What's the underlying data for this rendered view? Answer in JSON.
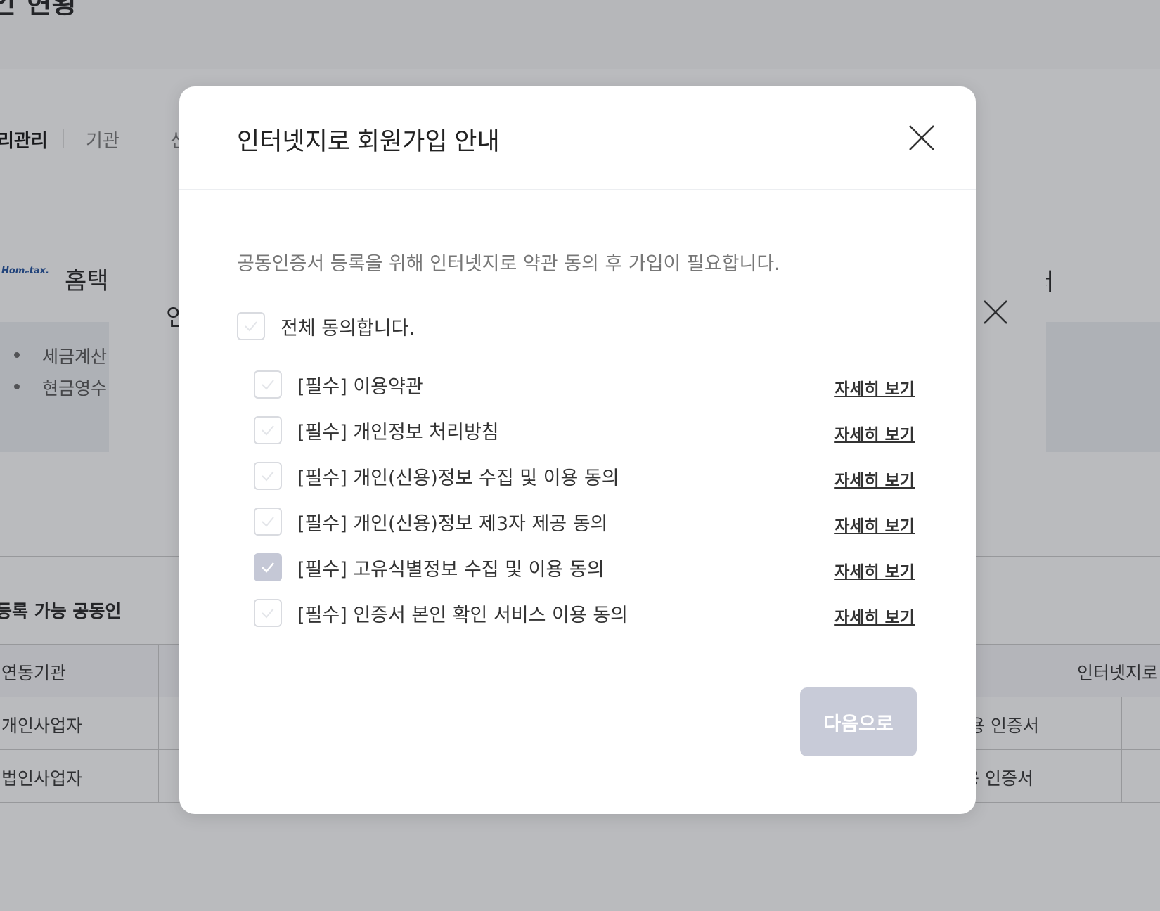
{
  "background": {
    "page_title_fragment": "인 현황",
    "tabs": [
      {
        "label": "리관리"
      },
      {
        "label": "기관"
      },
      {
        "label": "신"
      }
    ],
    "provider": {
      "logo_text": "Homₑtax.",
      "name_fragment": "홈택",
      "right_fragment": "서"
    },
    "info_items": [
      {
        "text": "세금계산"
      },
      {
        "text": "현금영수"
      }
    ],
    "secondary_modal_title_fragment": "인",
    "section_title_fragment": "등록 가능 공동인",
    "table": {
      "header": {
        "col1": "연동기관",
        "right": "인터넷지로"
      },
      "rows": [
        {
          "col1": "개인사업자",
          "right": "용 인증서"
        },
        {
          "col1": "법인사업자",
          "right": "용 인증서"
        }
      ]
    }
  },
  "dialog": {
    "title": "인터넷지로 회원가입 안내",
    "description": "공동인증서 등록을 위해 인터넷지로 약관 동의 후 가입이 필요합니다.",
    "agree_all_label": "전체 동의합니다.",
    "agree_all_checked": false,
    "terms": [
      {
        "label": "[필수] 이용약관",
        "link": "자세히 보기",
        "checked": false
      },
      {
        "label": "[필수] 개인정보 처리방침",
        "link": "자세히 보기",
        "checked": false
      },
      {
        "label": "[필수] 개인(신용)정보 수집 및 이용 동의",
        "link": "자세히 보기",
        "checked": false
      },
      {
        "label": "[필수] 개인(신용)정보 제3자 제공 동의",
        "link": "자세히 보기",
        "checked": false
      },
      {
        "label": "[필수] 고유식별정보 수집 및 이용 동의",
        "link": "자세히 보기",
        "checked": true
      },
      {
        "label": "[필수] 인증서 본인 확인 서비스 이용 동의",
        "link": "자세히 보기",
        "checked": false
      }
    ],
    "next_button_label": "다음으로",
    "next_button_enabled": false
  },
  "colors": {
    "overlay": "#282c34",
    "checkbox_border": "#d9dbe0",
    "checkbox_checked": "#c5c8d6",
    "button_disabled": "#c8cbd8"
  }
}
